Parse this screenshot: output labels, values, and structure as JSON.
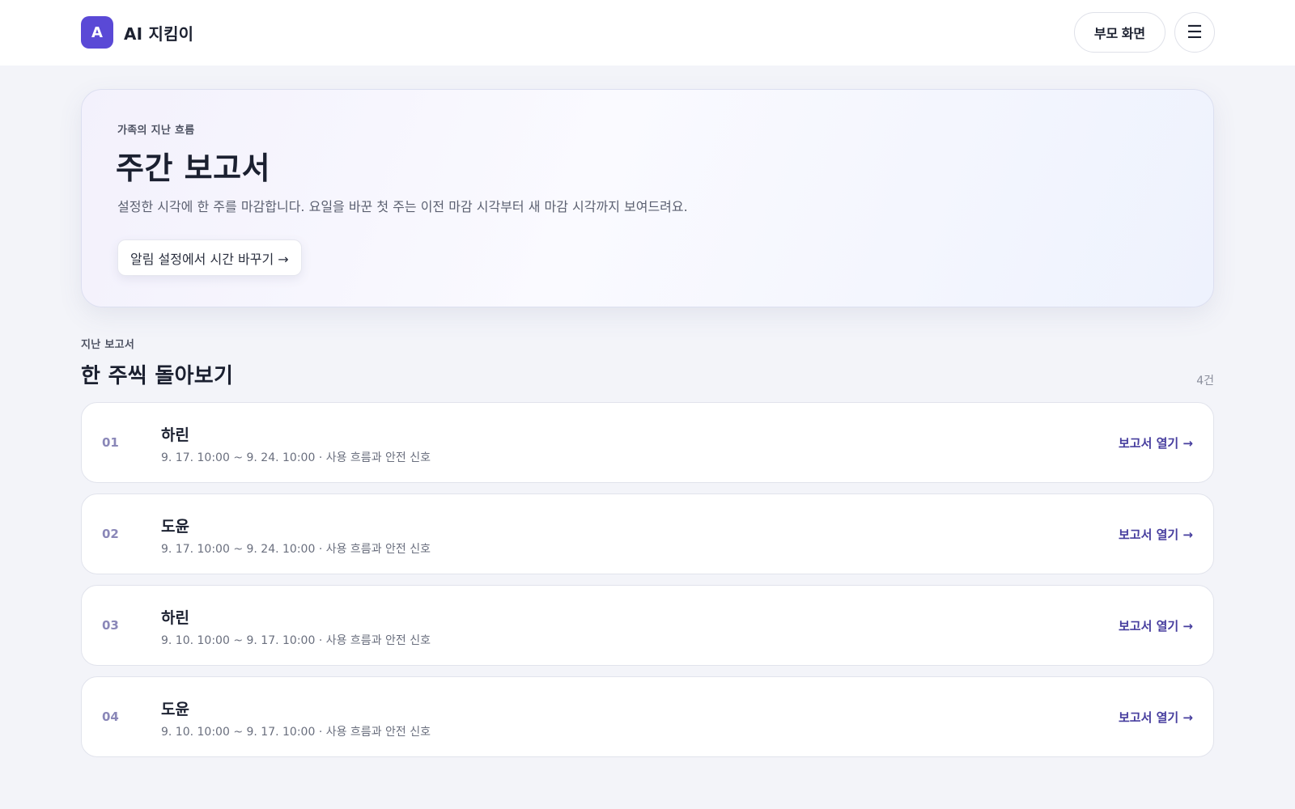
{
  "header": {
    "brand_initial": "A",
    "brand_name": "AI 지킴이",
    "parent_button_label": "부모 화면",
    "menu_icon_glyph": "☰",
    "menu_icon_name": "hamburger-menu-icon"
  },
  "hero": {
    "kicker": "가족의 지난 흐름",
    "title": "주간 보고서",
    "description": "설정한 시각에 한 주를 마감합니다. 요일을 바꾼 첫 주는 이전 마감 시각부터 새 마감 시각까지 보여드려요.",
    "action_label": "알림 설정에서 시간 바꾸기 →"
  },
  "section": {
    "kicker": "지난 보고서",
    "title": "한 주씩 돌아보기",
    "count": "4건"
  },
  "reports": [
    {
      "index": "01",
      "name": "하린",
      "meta": "9. 17. 10:00 ~ 9. 24. 10:00 · 사용 흐름과 안전 신호",
      "link": "보고서 열기 →"
    },
    {
      "index": "02",
      "name": "도윤",
      "meta": "9. 17. 10:00 ~ 9. 24. 10:00 · 사용 흐름과 안전 신호",
      "link": "보고서 열기 →"
    },
    {
      "index": "03",
      "name": "하린",
      "meta": "9. 10. 10:00 ~ 9. 17. 10:00 · 사용 흐름과 안전 신호",
      "link": "보고서 열기 →"
    },
    {
      "index": "04",
      "name": "도윤",
      "meta": "9. 10. 10:00 ~ 9. 17. 10:00 · 사용 흐름과 안전 신호",
      "link": "보고서 열기 →"
    }
  ],
  "colors": {
    "brand": "#5a49d6",
    "link": "#463d9e",
    "background": "#f3f4f9"
  }
}
